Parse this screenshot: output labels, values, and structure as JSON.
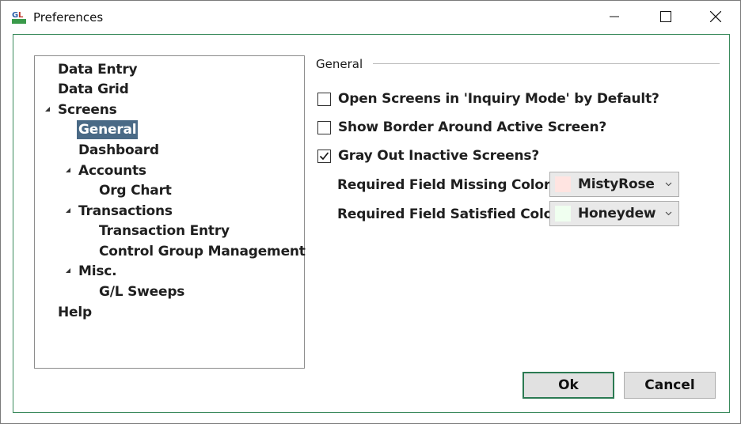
{
  "window": {
    "title": "Preferences",
    "app_icon": "gl-app-icon",
    "controls": [
      "minimize-icon",
      "maximize-icon",
      "close-icon"
    ]
  },
  "tree": {
    "items": [
      {
        "label": "Data Entry",
        "level": 0,
        "expanded": null
      },
      {
        "label": "Data Grid",
        "level": 0,
        "expanded": null
      },
      {
        "label": "Screens",
        "level": 0,
        "expanded": true
      },
      {
        "label": "General",
        "level": 1,
        "expanded": null,
        "selected": true
      },
      {
        "label": "Dashboard",
        "level": 1,
        "expanded": null
      },
      {
        "label": "Accounts",
        "level": 1,
        "expanded": true
      },
      {
        "label": "Org Chart",
        "level": 2,
        "expanded": null
      },
      {
        "label": "Transactions",
        "level": 1,
        "expanded": true
      },
      {
        "label": "Transaction Entry",
        "level": 2,
        "expanded": null
      },
      {
        "label": "Control Group Management",
        "level": 2,
        "expanded": null
      },
      {
        "label": "Misc.",
        "level": 1,
        "expanded": true
      },
      {
        "label": "G/L Sweeps",
        "level": 2,
        "expanded": null
      },
      {
        "label": "Help",
        "level": 0,
        "expanded": null
      }
    ]
  },
  "general": {
    "group_label": "General",
    "options": [
      {
        "label": "Open Screens in 'Inquiry Mode' by Default?",
        "checked": false
      },
      {
        "label": "Show Border Around Active Screen?",
        "checked": false
      },
      {
        "label": "Gray Out Inactive Screens?",
        "checked": true
      }
    ],
    "missing_color": {
      "label": "Required Field Missing Color:",
      "value": "MistyRose",
      "swatch": "#ffe4e1"
    },
    "satisfied_color": {
      "label": "Required Field Satisfied Color:",
      "value": "Honeydew",
      "swatch": "#f0fff0"
    }
  },
  "buttons": {
    "ok": "Ok",
    "cancel": "Cancel"
  },
  "colors": {
    "accent_border": "#3a8a5c",
    "selection": "#4a6a86"
  }
}
